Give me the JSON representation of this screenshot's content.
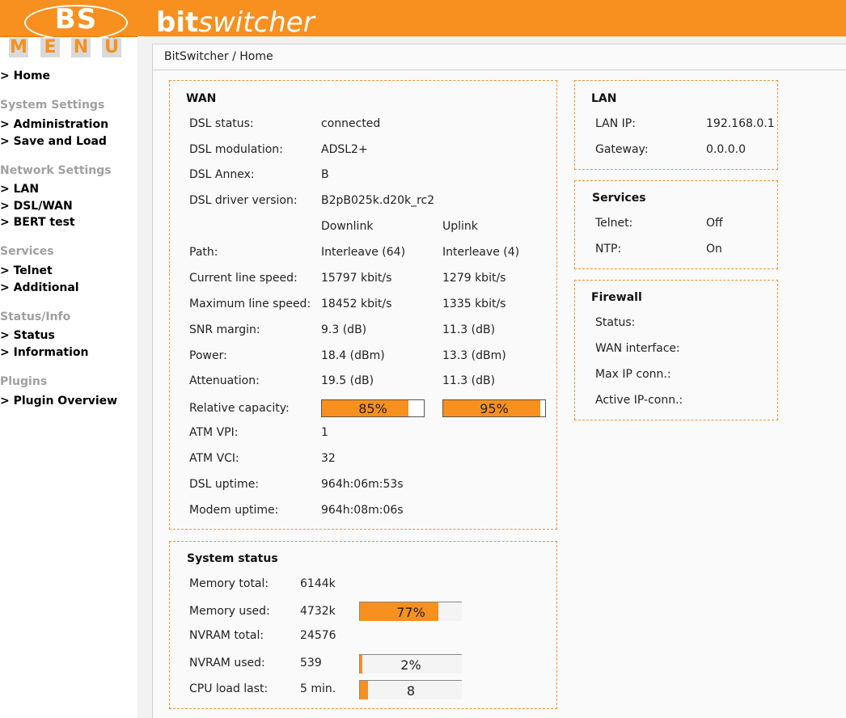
{
  "colors": {
    "accent": "#f7901e",
    "box_border": "#f29233",
    "nav_head": "#a0a0a0"
  },
  "logo": {
    "text": "BS",
    "menu_letters": [
      "M",
      "E",
      "N",
      "Ü"
    ]
  },
  "brand": {
    "bold": "bit",
    "italic": "switcher"
  },
  "breadcrumb": "BitSwitcher / Home",
  "nav": {
    "home": "> Home",
    "system_settings": "System Settings",
    "administration": "> Administration",
    "save_load": "> Save and Load",
    "network_settings": "Network Settings",
    "lan": "> LAN",
    "dsl_wan": "> DSL/WAN",
    "bert_test": "> BERT test",
    "services": "Services",
    "telnet": "> Telnet",
    "additional": "> Additional",
    "status_info": "Status/Info",
    "status": "> Status",
    "information": "> Information",
    "plugins": "Plugins",
    "plugin_overview": "> Plugin Overview"
  },
  "wan": {
    "title": "WAN",
    "dsl_status_label": "DSL status:",
    "dsl_status": "connected",
    "dsl_modulation_label": "DSL modulation:",
    "dsl_modulation": "ADSL2+",
    "dsl_annex_label": "DSL Annex:",
    "dsl_annex": "B",
    "driver_label": "DSL driver version:",
    "driver": "B2pB025k.d20k_rc2",
    "downlink_head": "Downlink",
    "uplink_head": "Uplink",
    "path_label": "Path:",
    "path_down": "Interleave (64)",
    "path_up": "Interleave (4)",
    "cur_speed_label": "Current line speed:",
    "cur_speed_down": "15797 kbit/s",
    "cur_speed_up": "1279 kbit/s",
    "max_speed_label": "Maximum line speed:",
    "max_speed_down": "18452 kbit/s",
    "max_speed_up": "1335 kbit/s",
    "snr_label": "SNR margin:",
    "snr_down": "9.3 (dB)",
    "snr_up": "11.3 (dB)",
    "power_label": "Power:",
    "power_down": "18.4 (dBm)",
    "power_up": "13.3 (dBm)",
    "atten_label": "Attenuation:",
    "atten_down": "19.5 (dB)",
    "atten_up": "11.3 (dB)",
    "rel_cap_label": "Relative capacity:",
    "rel_cap_down": "85%",
    "rel_cap_up": "95%",
    "rel_cap_down_value": 85,
    "rel_cap_up_value": 95,
    "vpi_label": "ATM VPI:",
    "vpi": "1",
    "vci_label": "ATM VCI:",
    "vci": "32",
    "dsl_uptime_label": "DSL uptime:",
    "dsl_uptime": "964h:06m:53s",
    "modem_uptime_label": "Modem uptime:",
    "modem_uptime": "964h:08m:06s"
  },
  "lan": {
    "title": "LAN",
    "ip_label": "LAN IP:",
    "ip": "192.168.0.1",
    "gateway_label": "Gateway:",
    "gateway": "0.0.0.0"
  },
  "services": {
    "title": "Services",
    "telnet_label": "Telnet:",
    "telnet": "Off",
    "ntp_label": "NTP:",
    "ntp": "On"
  },
  "firewall": {
    "title": "Firewall",
    "status_label": "Status:",
    "wan_if_label": "WAN interface:",
    "max_ip_label": "Max IP conn.:",
    "active_ip_label": "Active IP-conn.:"
  },
  "system": {
    "title": "System status",
    "mem_total_label": "Memory total:",
    "mem_total": "6144k",
    "mem_used_label": "Memory used:",
    "mem_used": "4732k",
    "mem_used_pct": "77%",
    "mem_used_value": 77,
    "nvram_total_label": "NVRAM total:",
    "nvram_total": "24576",
    "nvram_used_label": "NVRAM used:",
    "nvram_used": "539",
    "nvram_used_pct": "2%",
    "nvram_used_value": 2,
    "cpu_label": "CPU load last:",
    "cpu_period": "5 min.",
    "cpu_load": "8",
    "cpu_load_value": 8
  }
}
